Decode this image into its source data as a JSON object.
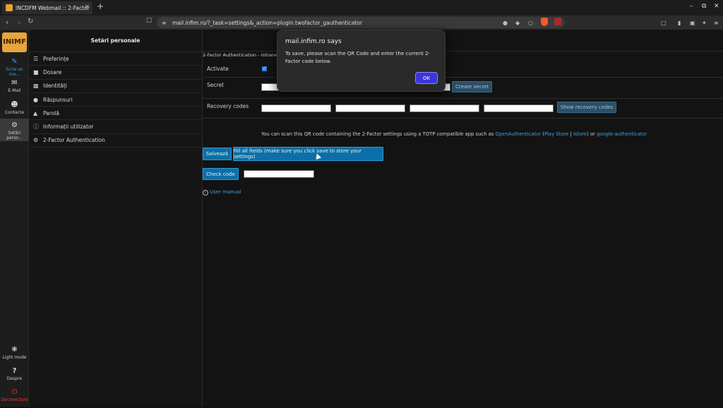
{
  "browser": {
    "tab_title": "INCDFM Webmail :: 2-Factor",
    "tab_close": "×",
    "new_tab": "+",
    "url": "mail.infim.ro/?_task=settings&_action=plugin.twofactor_gauthenticator",
    "win_minimize": "–",
    "win_restore": "⧉",
    "win_close": "✕"
  },
  "rail": {
    "logo_text": "INIMF",
    "items": [
      {
        "label": "Scrie un me...",
        "icon": "edit-icon"
      },
      {
        "label": "E-Mail",
        "icon": "mail-icon"
      },
      {
        "label": "Contacte",
        "icon": "contacts-icon"
      },
      {
        "label": "Setări perso...",
        "icon": "gear-icon"
      }
    ],
    "bottom_items": [
      {
        "label": "Light mode",
        "icon": "sun-icon"
      },
      {
        "label": "Despre",
        "icon": "question-icon"
      },
      {
        "label": "Deconectare",
        "icon": "power-icon"
      }
    ]
  },
  "sidebar": {
    "title": "Setări personale",
    "items": [
      {
        "label": "Preferințe",
        "icon": "sliders-icon"
      },
      {
        "label": "Dosare",
        "icon": "folder-icon"
      },
      {
        "label": "Identități",
        "icon": "id-card-icon"
      },
      {
        "label": "Răspunsuri",
        "icon": "speech-bubble-icon"
      },
      {
        "label": "Parolă",
        "icon": "lock-icon"
      },
      {
        "label": "Informații utilizator",
        "icon": "info-icon"
      },
      {
        "label": "2-Factor Authentication",
        "icon": "gear-icon"
      }
    ]
  },
  "main": {
    "section_title": "2-Factor Authentication - intranet",
    "activate_label": "Activate",
    "secret_label": "Secret",
    "create_secret_button": "Create secret",
    "recovery_label": "Recovery codes",
    "show_recovery_button": "Show recovery codes",
    "qr_note_prefix": "You can scan this QR code containing the 2-Factor settings using a TOTP compatible app such as ",
    "link_openauth": "OpenAuthenticator",
    "paren_open": " (",
    "link_playstore": "Play Store",
    "sep": " | ",
    "link_istore": "Istore",
    "paren_close_or": ") or ",
    "link_google": "google-authenticator",
    "save_button": "Salvează",
    "fill_fields_button": "Fill all fields (make sure you click save to store your settings)",
    "check_code_button": "Check code",
    "user_manual_link": "User manual",
    "info_glyph": "i"
  },
  "dialog": {
    "title": "mail.infim.ro says",
    "message": "To save, please scan the QR Code and enter the current 2-Factor code below.",
    "ok_button": "OK"
  },
  "colors": {
    "accent": "#3ba3e3",
    "dialog_ok": "#3b35d8",
    "logout": "#e04040"
  }
}
